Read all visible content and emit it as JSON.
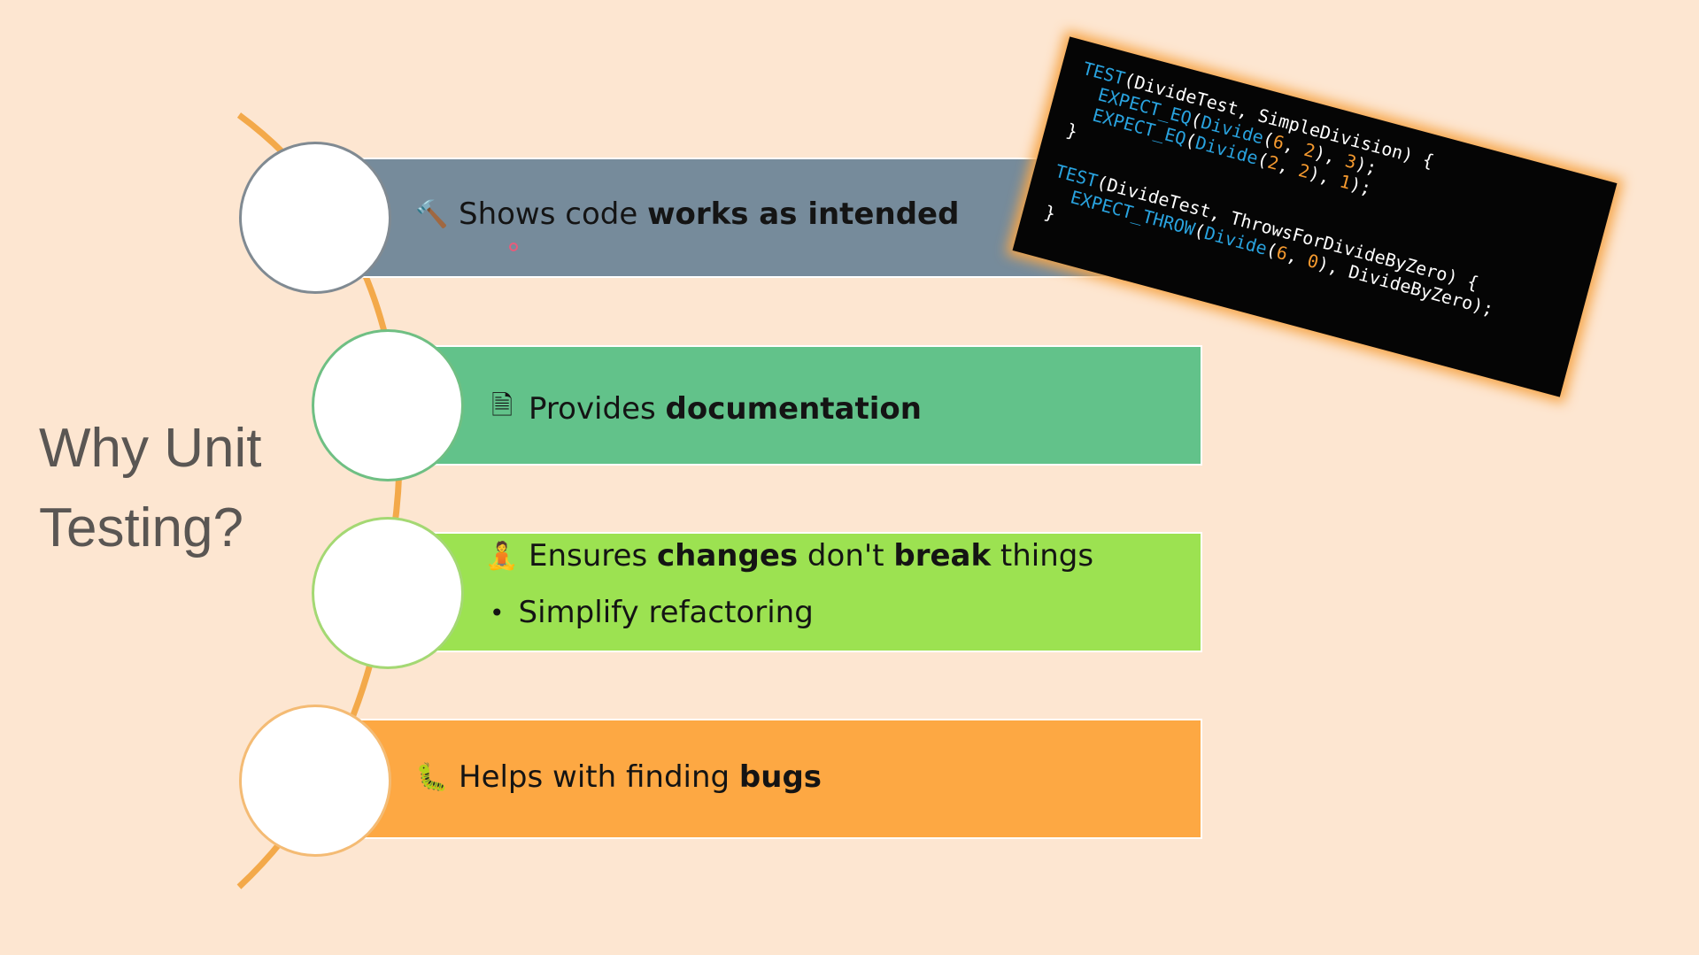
{
  "title": {
    "line1": "Why Unit",
    "line2": "Testing?"
  },
  "items": [
    {
      "icon": "hammer-icon",
      "glyph": "🔨",
      "plain1": "Shows code ",
      "bold1": "works as intended",
      "color": "#768b9b",
      "circle_border": "#808a92"
    },
    {
      "icon": "document-icon",
      "glyph": "🗎",
      "plain1": "Provides ",
      "bold1": "documentation",
      "color": "#62c28a",
      "circle_border": "#6fbf83"
    },
    {
      "icon": "meditation-icon",
      "glyph": "🧘",
      "plain1": "Ensures ",
      "bold1": "changes",
      "plain2": " don't ",
      "bold2": "break",
      "plain3": " things",
      "bullet": "Simplify refactoring",
      "color": "#9ce251",
      "circle_border": "#a4d873"
    },
    {
      "icon": "bug-icon",
      "glyph": "🐛",
      "plain1": "Helps with finding ",
      "bold1": "bugs",
      "color": "#fda843",
      "circle_border": "#f4bb74"
    }
  ],
  "code": {
    "l1a": "TEST",
    "l1b": "(DivideTest, SimpleDivision) {",
    "l2a": "EXPECT_EQ",
    "l2b": "(",
    "l2c": "Divide",
    "l2d": "(",
    "l2e": "6",
    "l2f": ", ",
    "l2g": "2",
    "l2h": "), ",
    "l2i": "3",
    "l2j": ");",
    "l3a": "EXPECT_EQ",
    "l3b": "(",
    "l3c": "Divide",
    "l3d": "(",
    "l3e": "2",
    "l3f": ", ",
    "l3g": "2",
    "l3h": "), ",
    "l3i": "1",
    "l3j": ");",
    "l4": "}",
    "l5a": "TEST",
    "l5b": "(DivideTest, ThrowsForDivideByZero) {",
    "l6a": "EXPECT_THROW",
    "l6b": "(",
    "l6c": "Divide",
    "l6d": "(",
    "l6e": "6",
    "l6f": ", ",
    "l6g": "0",
    "l6h": "), DivideByZero);",
    "l7": "}"
  },
  "colors": {
    "background": "#fde6d1",
    "spine": "#f3a94a",
    "title": "#5a5653"
  }
}
